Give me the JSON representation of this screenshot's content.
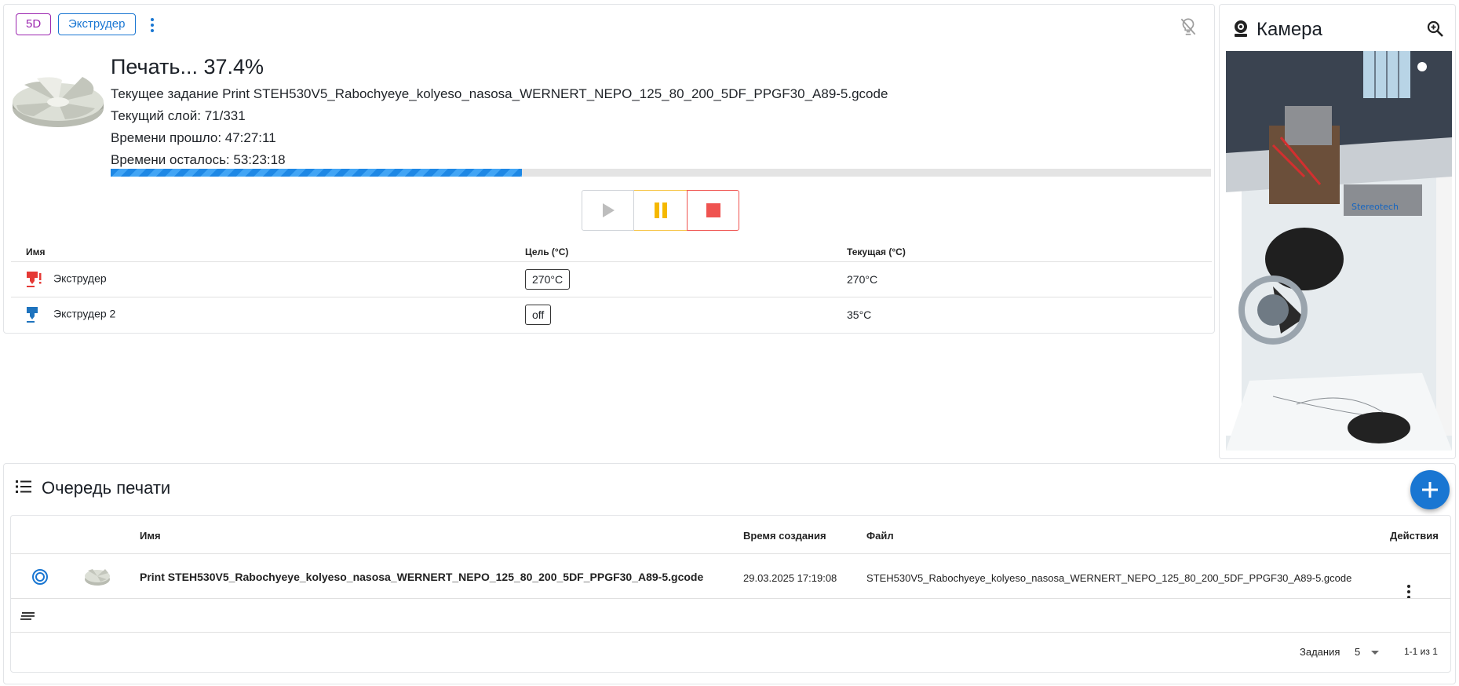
{
  "status": {
    "chip_5d": "5D",
    "chip_extruder": "Экструдер",
    "title": "Печать... 37.4%",
    "current_job": "Текущее задание Print STEH530V5_Rabochyeye_kolyeso_nasosa_WERNERT_NEPO_125_80_200_5DF_PPGF30_A89-5.gcode",
    "current_layer": "Текущий слой: 71/331",
    "elapsed": "Времени прошло: 47:27:11",
    "remaining": "Времени осталось: 53:23:18",
    "progress_percent": 37.4,
    "progress_color": "#1e88e5"
  },
  "controls": {
    "play_color": "#bdbdbd",
    "pause_color": "#f5b800",
    "stop_color": "#ef5350"
  },
  "temps": {
    "headers": {
      "name": "Имя",
      "target": "Цель (°C)",
      "current": "Текущая (°C)"
    },
    "rows": [
      {
        "name": "Экструдер",
        "target": "270°C",
        "current": "270°C",
        "icon": "extruder-hot-icon",
        "color": "#e53935"
      },
      {
        "name": "Экструдер 2",
        "target": "off",
        "current": "35°C",
        "icon": "extruder-icon",
        "color": "#1e73be"
      }
    ]
  },
  "camera": {
    "title": "Камера",
    "brand": "Stereotech"
  },
  "queue": {
    "title": "Очередь печати",
    "headers": {
      "name": "Имя",
      "created": "Время создания",
      "file": "Файл",
      "actions": "Действия"
    },
    "rows": [
      {
        "name": "Print STEH530V5_Rabochyeye_kolyeso_nasosa_WERNERT_NEPO_125_80_200_5DF_PPGF30_A89-5.gcode",
        "created": "29.03.2025 17:19:08",
        "file": "STEH530V5_Rabochyeye_kolyeso_nasosa_WERNERT_NEPO_125_80_200_5DF_PPGF30_A89-5.gcode"
      }
    ],
    "footer": {
      "per_page_label": "Задания",
      "per_page_value": "5",
      "range": "1-1 из 1"
    },
    "accent": "#1976d2"
  }
}
